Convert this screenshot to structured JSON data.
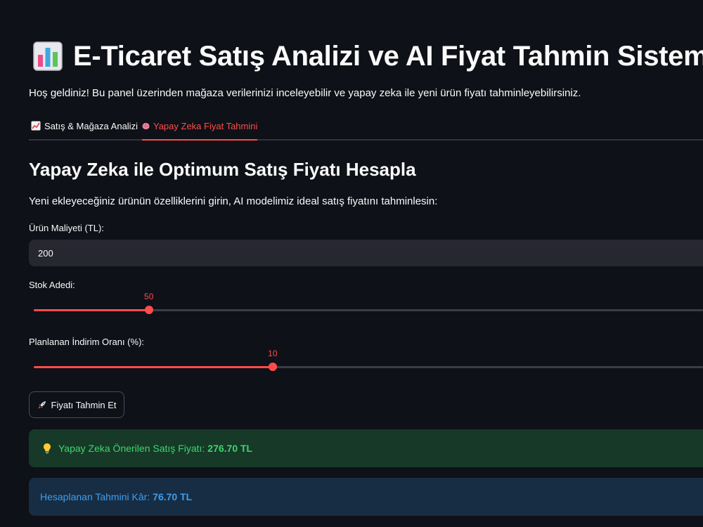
{
  "header": {
    "title": "E-Ticaret Satış Analizi ve AI Fiyat Tahmin Sistemi",
    "title_icon": "bar-chart-icon",
    "welcome": "Hoş geldiniz! Bu panel üzerinden mağaza verilerinizi inceleyebilir ve yapay zeka ile yeni ürün fiyatı tahminleyebilirsiniz."
  },
  "tabs": [
    {
      "label": "Satış & Mağaza Analizi",
      "icon": "chart-increasing-icon",
      "active": false
    },
    {
      "label": "Yapay Zeka Fiyat Tahmini",
      "icon": "brain-icon",
      "active": true
    }
  ],
  "main": {
    "heading": "Yapay Zeka ile Optimum Satış Fiyatı Hesapla",
    "description": "Yeni ekleyeceğiniz ürünün özelliklerini girin, AI modelimiz ideal satış fiyatını tahminlesin:",
    "cost": {
      "label": "Ürün Maliyeti (TL):",
      "value": "200"
    },
    "stock": {
      "label": "Stok Adedi:",
      "value": "50",
      "fraction": 0.172
    },
    "discount": {
      "label": "Planlanan İndirim Oranı (%):",
      "value": "10",
      "fraction": 0.357
    },
    "predict_button": {
      "label": "Fiyatı Tahmin Et",
      "icon": "rocket-icon"
    },
    "result": {
      "label": "Yapay Zeka Önerilen Satış Fiyatı:",
      "value": "276.70 TL",
      "icon": "light-bulb-icon"
    },
    "profit": {
      "label": "Hesaplanan Tahmini Kâr:",
      "value": "76.70 TL"
    }
  },
  "colors": {
    "background": "#0e1117",
    "accent": "#ff4b4b",
    "success_bg": "#173928",
    "success_text": "#3dd56d",
    "info_bg": "#172d43",
    "info_text": "#3d9df3"
  }
}
